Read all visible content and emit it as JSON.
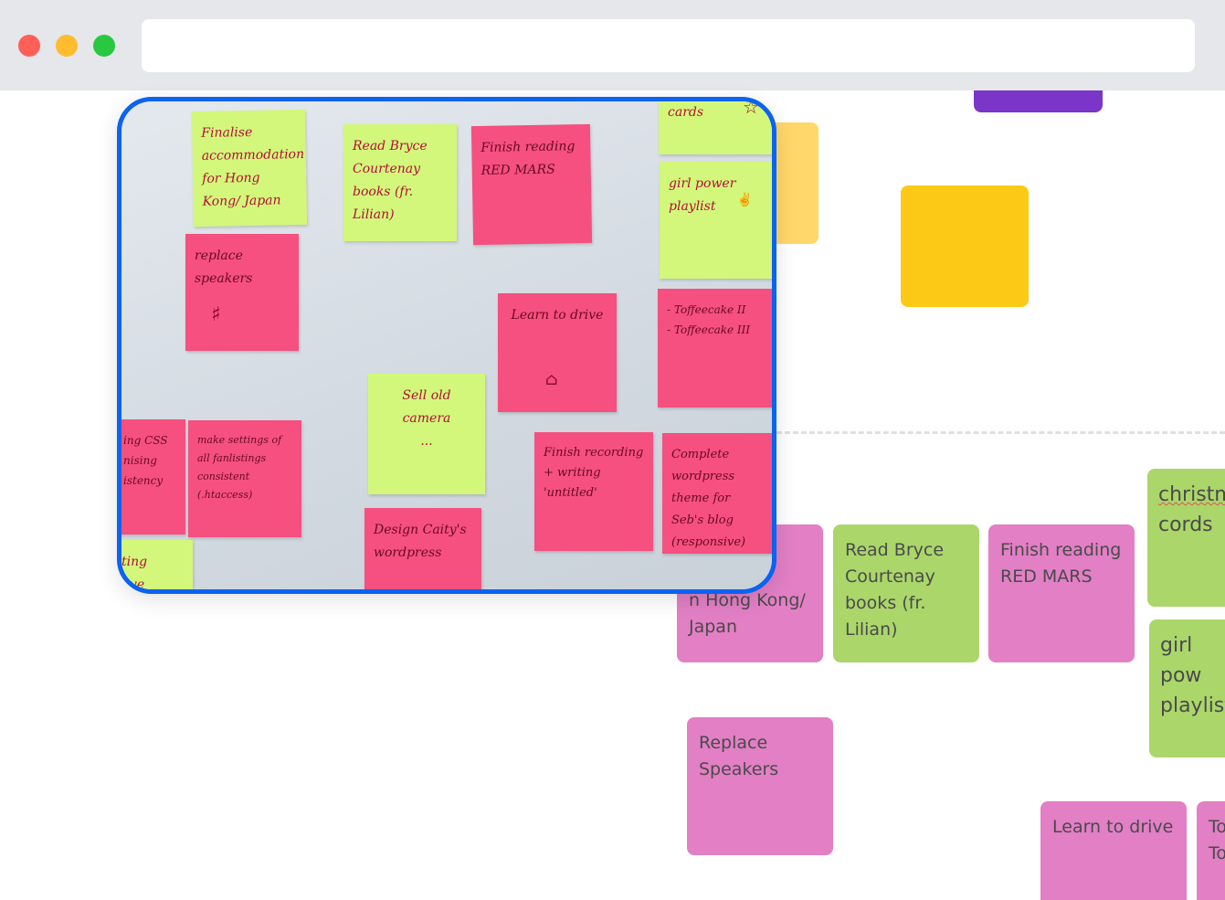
{
  "browser": {
    "url": ""
  },
  "canvas_notes": [
    {
      "text": "Finalise accommodation for Hong Kong/ Japan",
      "visible": "...datio\nn Hong Kong/\nJapan"
    },
    {
      "text": "Read Bryce Courtenay books (fr. Lilian)"
    },
    {
      "text": "Finish reading RED MARS"
    },
    {
      "text_1": "christm",
      "text_2": "cords"
    },
    {
      "text": "girl pow\nplaylist"
    },
    {
      "text": "Replace Speakers"
    },
    {
      "text": "Learn to drive"
    },
    {
      "text": "To\nTo"
    }
  ],
  "photo_notes": [
    {
      "text": "Finalise accommodation for Hong Kong/ Japan"
    },
    {
      "text": "Read Bryce Courtenay books (fr. Lilian)"
    },
    {
      "text": "Finish reading RED MARS"
    },
    {
      "text": "cards",
      "icon": "star-icon"
    },
    {
      "text": "girl power playlist",
      "icon": "hand-icon"
    },
    {
      "text": "replace speakers",
      "icon": "speaker-doodle-icon"
    },
    {
      "text": "Learn to drive",
      "icon": "car-doodle-icon"
    },
    {
      "text": "- Toffeecake II\n- Toffeecake III"
    },
    {
      "text": "Sell old camera\n..."
    },
    {
      "text": "ing CSS\nnising\nistency"
    },
    {
      "text": "make settings of all fanlistings consistent (.htaccess)"
    },
    {
      "text": "Finish recording + writing 'untitled'"
    },
    {
      "text": "Complete wordpress theme for Seb's blog (responsive)"
    },
    {
      "text": "Design Caity's wordpress"
    },
    {
      "text": "ting\nlive"
    }
  ],
  "colors": {
    "accent_border": "#0b63f0",
    "purple": "#7b35c9",
    "amber": "#fcc916",
    "light_amber": "#ffd76a",
    "note_pink": "#e27fc5",
    "note_green": "#abd66a"
  }
}
